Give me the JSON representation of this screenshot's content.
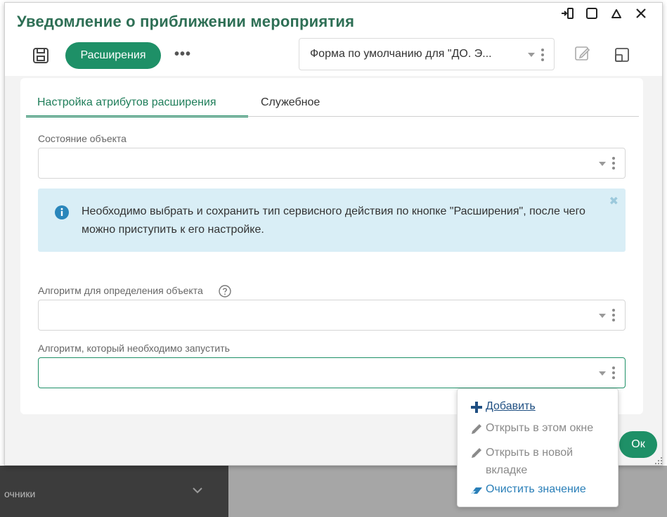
{
  "dialog": {
    "title": "Уведомление о приближении мероприятия",
    "window_controls": [
      "exit-icon",
      "maximize-icon",
      "collapse-icon",
      "close-icon"
    ]
  },
  "toolbar": {
    "extensions_label": "Расширения",
    "more_label": "•••",
    "form_select_value": "Форма по умолчанию для \"ДО. Э..."
  },
  "tabs": [
    {
      "label": "Настройка атрибутов расширения",
      "active": true
    },
    {
      "label": "Служебное",
      "active": false
    }
  ],
  "fields": {
    "object_state": {
      "label": "Состояние объекта",
      "value": ""
    },
    "detect_algorithm": {
      "label": "Алгоритм для определения объекта",
      "value": ""
    },
    "run_algorithm": {
      "label": "Алгоритм, который необходимо запустить",
      "value": ""
    }
  },
  "info": {
    "text": "Необходимо выбрать и сохранить тип сервисного действия по кнопке \"Расширения\", после чего можно приступить к его настройке.",
    "close_symbol": "✖"
  },
  "menu": {
    "add": "Добавить",
    "open_here": "Открыть в этом окне",
    "open_new_tab": "Открыть в новой вкладке",
    "clear": "Очистить значение"
  },
  "ok_label": "Ок",
  "background": {
    "nav_label": "очники"
  },
  "colors": {
    "accent": "#1e9067",
    "title": "#2e6f55",
    "info_bg": "#d9eef6",
    "link": "#1f4f82"
  }
}
